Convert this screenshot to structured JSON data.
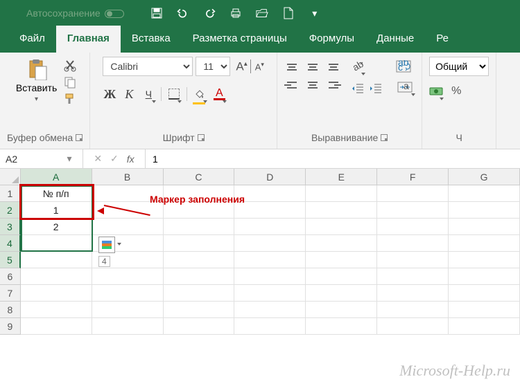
{
  "titlebar": {
    "autosave": "Автосохранение"
  },
  "tabs": {
    "file": "Файл",
    "home": "Главная",
    "insert": "Вставка",
    "pagesetup": "Разметка страницы",
    "formulas": "Формулы",
    "data": "Данные",
    "rev": "Ре"
  },
  "ribbon": {
    "clipboard": {
      "paste": "Вставить",
      "label": "Буфер обмена"
    },
    "font": {
      "name": "Calibri",
      "size": "11",
      "label": "Шрифт",
      "bold": "Ж",
      "italic": "К",
      "underline": "Ч"
    },
    "align": {
      "label": "Выравнивание"
    },
    "number": {
      "format": "Общий",
      "label": "Ч"
    }
  },
  "formula_bar": {
    "name": "A2",
    "value": "1"
  },
  "columns": [
    "A",
    "B",
    "C",
    "D",
    "E",
    "F",
    "G"
  ],
  "rows": [
    "1",
    "2",
    "3",
    "4",
    "5",
    "6",
    "7",
    "8",
    "9"
  ],
  "cells": {
    "A1": "№ п/п",
    "A2": "1",
    "A3": "2"
  },
  "annotation": {
    "text": "Маркер заполнения",
    "tooltip": "4"
  },
  "watermark": "Microsoft-Help.ru"
}
